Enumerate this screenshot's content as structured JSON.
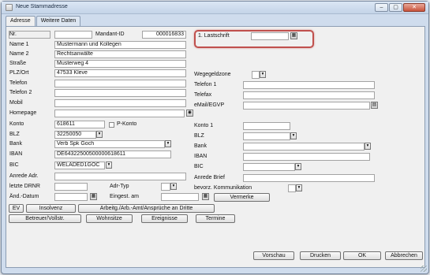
{
  "window": {
    "title": "Neue Stammadresse",
    "minimize": "–",
    "maximize": "▢",
    "close": "✕"
  },
  "tabs": [
    "Adresse",
    "Weitere Daten"
  ],
  "left": {
    "nr_label": "Nr.",
    "nr_value": "",
    "mandant_label": "Mandant-ID",
    "mandant_value": "000016833",
    "name1_label": "Name 1",
    "name1_value": "Mustermann und Kollegen",
    "name2_label": "Name 2",
    "name2_value": "Rechtsanwälte",
    "strasse_label": "Straße",
    "strasse_value": "Musterweg 4",
    "plz_label": "PLZ/Ort",
    "plz_value": "47533 Kleve",
    "telefon_label": "Telefon",
    "telefon2_label": "Telefon 2",
    "mobil_label": "Mobil",
    "homepage_label": "Homepage",
    "konto_label": "Konto",
    "konto_value": "618611",
    "pkonto_label": "P-Konto",
    "blz_label": "BLZ",
    "blz_value": "32250050",
    "bank_label": "Bank",
    "bank_value": "Verb Spk Goch",
    "iban_label": "IBAN",
    "iban_value": "DE64322500500000618611",
    "bic_label": "BIC",
    "bic_value": "WELADED1GOC",
    "anrede_label": "Anrede Adr.",
    "drnr_label": "letzte DRNR",
    "adrtyp_label": "Adr-Typ",
    "aend_label": "Änd.-Datum",
    "eingest_label": "Eingest. am"
  },
  "right": {
    "lastschrift_label": "1. Lastschrift",
    "wegegeld_label": "Wegegeldzone",
    "telefon1_label": "Telefon 1",
    "telefax_label": "Telefax",
    "email_label": "eMail/EGVP",
    "konto1_label": "Konto 1",
    "blz_label": "BLZ",
    "bank_label": "Bank",
    "iban_label": "IBAN",
    "bic_label": "BIC",
    "anrede_brief_label": "Anrede Brief",
    "kommunikation_label": "bevorz. Kommunikation",
    "vermerke_button": "Vermerke"
  },
  "buttons_row1": {
    "ev": "EV",
    "insolvenz": "Insolvenz",
    "arbeitg": "Arbeitg./Arb.-Amt/Ansprüche an Dritte"
  },
  "buttons_row2": {
    "betreuer": "Betreuer/Vollstr.",
    "wohnsitze": "Wohnsitze",
    "ereignisse": "Ereignisse",
    "termine": "Termine"
  },
  "footer": {
    "vorschau": "Vorschau",
    "drucken": "Drucken",
    "ok": "OK",
    "abbrechen": "Abbrechen"
  }
}
